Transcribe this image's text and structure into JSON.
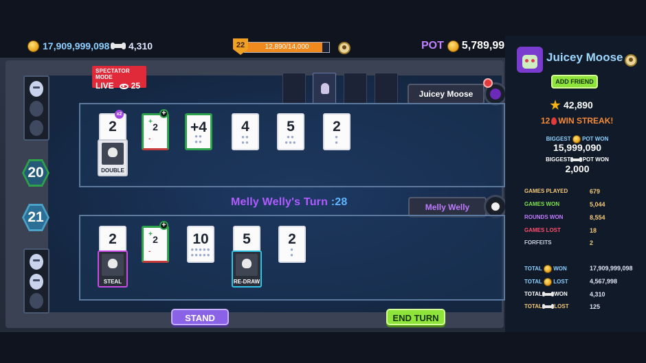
{
  "header": {
    "coins": "17,909,999,098",
    "bones": "4,310",
    "level": "22",
    "xp_text": "12,890/14,000",
    "xp_progress": 0.92,
    "pot_label": "POT",
    "pot_value": "5,789,99"
  },
  "spectator": {
    "mode_label": "SPECTATOR MODE",
    "live_label": "LIVE",
    "viewers": "25"
  },
  "opponent": {
    "name": "Juicey Moose",
    "score": "20",
    "cards": [
      {
        "value": "2",
        "badge": "x2",
        "special": "DOUBLE"
      },
      {
        "value": "2",
        "type": "plus-minus"
      },
      {
        "value": "+4",
        "type": "green"
      },
      {
        "value": "4"
      },
      {
        "value": "5"
      },
      {
        "value": "2"
      }
    ]
  },
  "turn": {
    "text": "Melly Welly's Turn",
    "timer": ":28"
  },
  "player": {
    "name": "Melly Welly",
    "score": "21",
    "cards": [
      {
        "value": "2",
        "special": "STEAL"
      },
      {
        "value": "2",
        "type": "plus-minus"
      },
      {
        "value": "10"
      },
      {
        "value": "5",
        "special": "RE-DRAW"
      },
      {
        "value": "2"
      }
    ]
  },
  "buttons": {
    "stand": "STAND",
    "end_turn": "END TURN"
  },
  "profile": {
    "name": "Juicey Moose",
    "add_friend": "ADD FRIEND",
    "rating": "42,890",
    "streak_count": "12",
    "streak_label": "WIN STREAK!",
    "biggest_label": "BIGGEST",
    "pot_won_label": "POT WON",
    "biggest_coin_pot": "15,999,090",
    "biggest_bone_pot": "2,000",
    "stats": [
      {
        "label": "GAMES PLAYED",
        "value": "679",
        "color": "#f2c879"
      },
      {
        "label": "GAMES WON",
        "value": "5,044",
        "color": "#7ee04a"
      },
      {
        "label": "ROUNDS WON",
        "value": "8,554",
        "color": "#c07aff"
      },
      {
        "label": "GAMES LOST",
        "value": "18",
        "color": "#ff4d6d"
      },
      {
        "label": "FORFEITS",
        "value": "2",
        "color": "#c9d0e0"
      }
    ],
    "totals": [
      {
        "label_a": "TOTAL",
        "label_b": "WON",
        "value": "17,909,999,098",
        "icon": "coin",
        "color": "#8ed0ff"
      },
      {
        "label_a": "TOTAL",
        "label_b": "LOST",
        "value": "4,567,998",
        "icon": "coin",
        "color": "#8ed0ff"
      },
      {
        "label_a": "TOTAL",
        "label_b": "WON",
        "value": "4,310",
        "icon": "bone",
        "color": "#ffffff"
      },
      {
        "label_a": "TOTAL",
        "label_b": "LOST",
        "value": "125",
        "icon": "bone",
        "color": "#f2c879"
      }
    ]
  }
}
